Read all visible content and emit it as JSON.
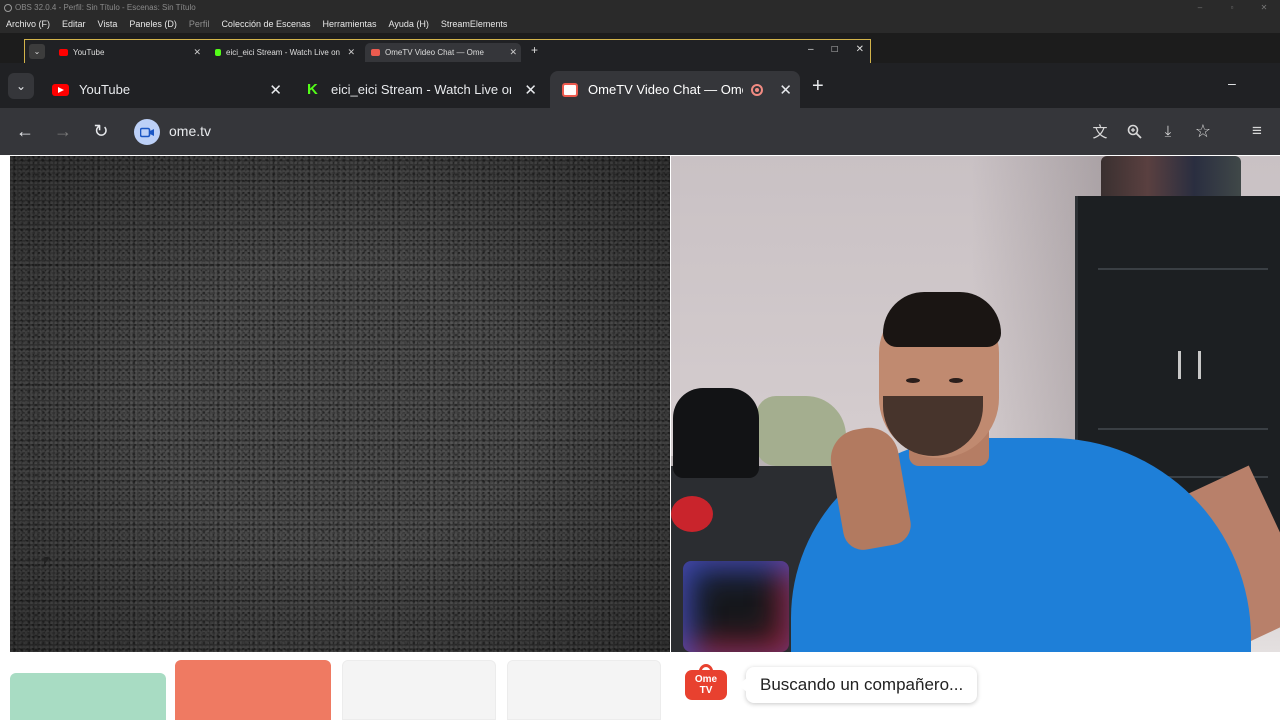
{
  "obs": {
    "title": "OBS 32.0.4 - Perfil: Sin Título - Escenas: Sin Título",
    "menu": [
      {
        "label": "Archivo (F)",
        "dim": false
      },
      {
        "label": "Editar",
        "dim": false
      },
      {
        "label": "Vista",
        "dim": false
      },
      {
        "label": "Paneles (D)",
        "dim": false
      },
      {
        "label": "Perfil",
        "dim": true
      },
      {
        "label": "Colección de Escenas",
        "dim": false
      },
      {
        "label": "Herramientas",
        "dim": false
      },
      {
        "label": "Ayuda (H)",
        "dim": false
      },
      {
        "label": "StreamElements",
        "dim": false
      }
    ],
    "window_controls": [
      "–",
      "▫",
      "✕"
    ]
  },
  "mini_browser": {
    "dropdown": "⌄",
    "tabs": [
      {
        "title": "YouTube",
        "favicon_color": "#ff0000"
      },
      {
        "title": "eici_eici Stream - Watch Live on",
        "favicon_color": "#53fc18"
      },
      {
        "title": "OmeTV Video Chat — Ome",
        "favicon_color": "#ec5b4f"
      }
    ],
    "new_tab": "+",
    "controls": [
      "–",
      "□",
      "✕"
    ]
  },
  "browser": {
    "tabs_dropdown": "⌄",
    "tabs": [
      {
        "title": "YouTube",
        "favicon": "youtube-icon",
        "active": false
      },
      {
        "title": "eici_eici Stream - Watch Live on",
        "favicon": "kick-icon",
        "active": false
      },
      {
        "title": "OmeTV Video Chat — Ome",
        "favicon": "ometv-icon",
        "active": true,
        "recording": true
      }
    ],
    "close_glyph": "✕",
    "new_tab": "+",
    "minimize": "–",
    "nav": {
      "back": "←",
      "forward": "→",
      "reload": "↻"
    },
    "url": "ome.tv",
    "toolbar_icons": [
      "translate-icon",
      "zoom-icon",
      "install-app-icon",
      "bookmark-star-icon",
      "reading-list-icon"
    ],
    "toolbar_glyphs": {
      "translate": "⽂",
      "zoom": "🔍",
      "install": "⤓",
      "star": "☆",
      "list": "≡"
    }
  },
  "page": {
    "status_text": "Buscando un compañero...",
    "logo_line1": "Ome",
    "logo_line2": "TV",
    "buttons": [
      {
        "name": "start-button",
        "color": "#a8dcc3"
      },
      {
        "name": "stop-button",
        "color": "#ef7a62"
      },
      {
        "name": "option-button-1",
        "color": "#f5f5f5"
      },
      {
        "name": "option-button-2",
        "color": "#f5f5f5"
      }
    ]
  }
}
